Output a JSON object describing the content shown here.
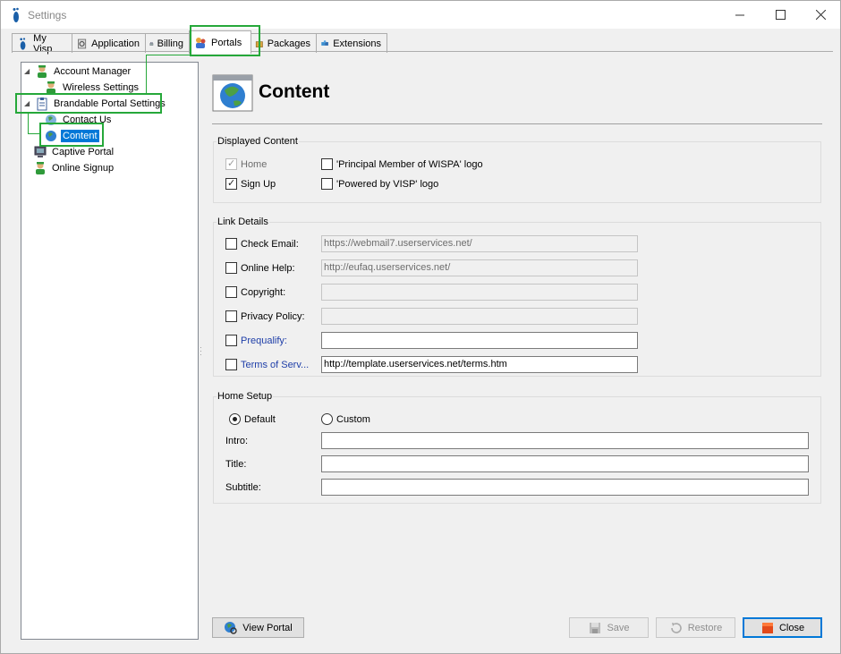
{
  "window": {
    "title": "Settings"
  },
  "tabs": [
    {
      "label": "My Visp",
      "icon": "foot-icon"
    },
    {
      "label": "Application",
      "icon": "gear-icon"
    },
    {
      "label": "Billing",
      "icon": "register-icon"
    },
    {
      "label": "Portals",
      "icon": "portals-icon"
    },
    {
      "label": "Packages",
      "icon": "package-icon"
    },
    {
      "label": "Extensions",
      "icon": "puzzle-icon"
    }
  ],
  "tree": {
    "account_manager": "Account Manager",
    "wireless_settings": "Wireless Settings",
    "brandable_portal_settings": "Brandable Portal Settings",
    "contact_us": "Contact Us",
    "content": "Content",
    "captive_portal": "Captive Portal",
    "online_signup": "Online Signup"
  },
  "header": {
    "title": "Content",
    "icon": "globe-window-icon"
  },
  "displayed_content": {
    "title": "Displayed Content",
    "home": {
      "label": "Home",
      "checked": true,
      "enabled": false
    },
    "sign_up": {
      "label": "Sign Up",
      "checked": true
    },
    "wispa_logo": {
      "label": "'Principal Member of WISPA' logo",
      "checked": false
    },
    "visp_logo": {
      "label": "'Powered by VISP' logo",
      "checked": false
    }
  },
  "link_details": {
    "title": "Link Details",
    "check_email": {
      "label": "Check Email:",
      "value": "https://webmail7.userservices.net/"
    },
    "online_help": {
      "label": "Online Help:",
      "value": "http://eufaq.userservices.net/"
    },
    "copyright": {
      "label": "Copyright:",
      "value": ""
    },
    "privacy_policy": {
      "label": "Privacy Policy:",
      "value": ""
    },
    "prequalify": {
      "label": "Prequalify:",
      "value": ""
    },
    "terms": {
      "label": "Terms of Serv...",
      "value": "http://template.userservices.net/terms.htm"
    }
  },
  "home_setup": {
    "title": "Home Setup",
    "default_label": "Default",
    "custom_label": "Custom",
    "selected": "Default",
    "intro_label": "Intro:",
    "title_label": "Title:",
    "subtitle_label": "Subtitle:",
    "intro_value": "",
    "title_value": "",
    "subtitle_value": ""
  },
  "buttons": {
    "view_portal": "View Portal",
    "save": "Save",
    "restore": "Restore",
    "close": "Close"
  },
  "colors": {
    "highlight": "#26a83a",
    "selection": "#0078d7",
    "link": "#1e3ea8"
  }
}
